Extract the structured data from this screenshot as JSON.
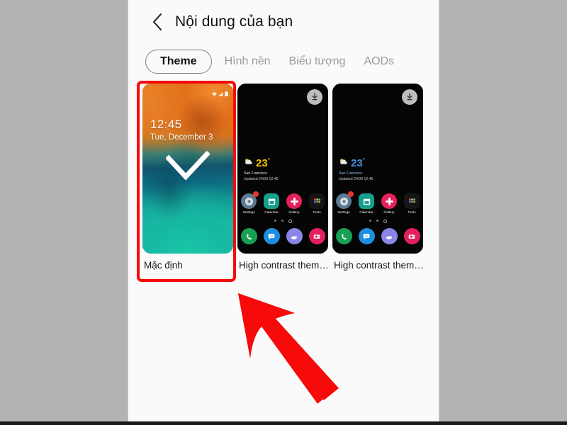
{
  "app": {
    "header": {
      "back_icon": "chevron-left-icon",
      "title": "Nội dung của bạn"
    },
    "tabs": [
      {
        "label": "Theme",
        "selected": true
      },
      {
        "label": "Hình nền",
        "selected": false
      },
      {
        "label": "Biểu tượng",
        "selected": false
      },
      {
        "label": "AODs",
        "selected": false
      }
    ],
    "themes": [
      {
        "label": "Mặc định",
        "selected": true,
        "type": "wallpaper-preview",
        "lock_time": "12:45",
        "lock_date": "Tue, December 3",
        "check_icon": "check-icon",
        "status_icons": [
          "wifi-icon",
          "signal-icon",
          "battery-icon"
        ]
      },
      {
        "label": "High contrast them…",
        "selected": false,
        "type": "dark-home-preview",
        "download_icon": "download-icon",
        "weather": {
          "icon": "partly-cloudy-icon",
          "temperature": "23",
          "degree": "°",
          "temp_color": "#f2c200",
          "location_icon": "pin-icon",
          "city": "San Francisco",
          "updated": "Updated 24/09 12:45"
        },
        "apps": [
          {
            "name": "Settings",
            "icon": "gear-icon",
            "color": "#5a7a92",
            "badge": "1"
          },
          {
            "name": "Calendar",
            "icon": "calendar-icon",
            "color": "#14a08a",
            "badge": ""
          },
          {
            "name": "Gallery",
            "icon": "flower-icon",
            "color": "#e4215c",
            "badge": ""
          },
          {
            "name": "Tools",
            "icon": "folder-icon",
            "color": "#1a1a1a",
            "badge": ""
          }
        ],
        "dock": [
          {
            "name": "Phone",
            "icon": "phone-icon",
            "color": "#18a055"
          },
          {
            "name": "Messages",
            "icon": "message-icon",
            "color": "#1d8fe0"
          },
          {
            "name": "Internet",
            "icon": "browser-icon",
            "color": "#8a86e8"
          },
          {
            "name": "Camera",
            "icon": "camera-icon",
            "color": "#e4215c"
          }
        ]
      },
      {
        "label": "High contrast them…",
        "selected": false,
        "type": "dark-home-preview",
        "download_icon": "download-icon",
        "weather": {
          "icon": "partly-cloudy-icon",
          "temperature": "23",
          "degree": "°",
          "temp_color": "#4a8fe0",
          "location_icon": "pin-icon",
          "city": "San Francisco",
          "updated": "Updated 24/09 12:45",
          "city_color": "#7fb6ef"
        },
        "apps": [
          {
            "name": "Settings",
            "icon": "gear-icon",
            "color": "#5a7a92",
            "badge": "1"
          },
          {
            "name": "Calendar",
            "icon": "calendar-icon",
            "color": "#14a08a",
            "badge": ""
          },
          {
            "name": "Gallery",
            "icon": "flower-icon",
            "color": "#e4215c",
            "badge": ""
          },
          {
            "name": "Tools",
            "icon": "folder-icon",
            "color": "#1a1a1a",
            "badge": ""
          }
        ],
        "dock": [
          {
            "name": "Phone",
            "icon": "phone-icon",
            "color": "#18a055"
          },
          {
            "name": "Messages",
            "icon": "message-icon",
            "color": "#1d8fe0"
          },
          {
            "name": "Internet",
            "icon": "browser-icon",
            "color": "#8a86e8"
          },
          {
            "name": "Camera",
            "icon": "camera-icon",
            "color": "#e4215c"
          }
        ]
      }
    ],
    "annotations": {
      "highlight_color": "#f60a0a",
      "arrow_icon": "arrow-up-left-icon",
      "arrow_color": "#f60a0a"
    }
  }
}
